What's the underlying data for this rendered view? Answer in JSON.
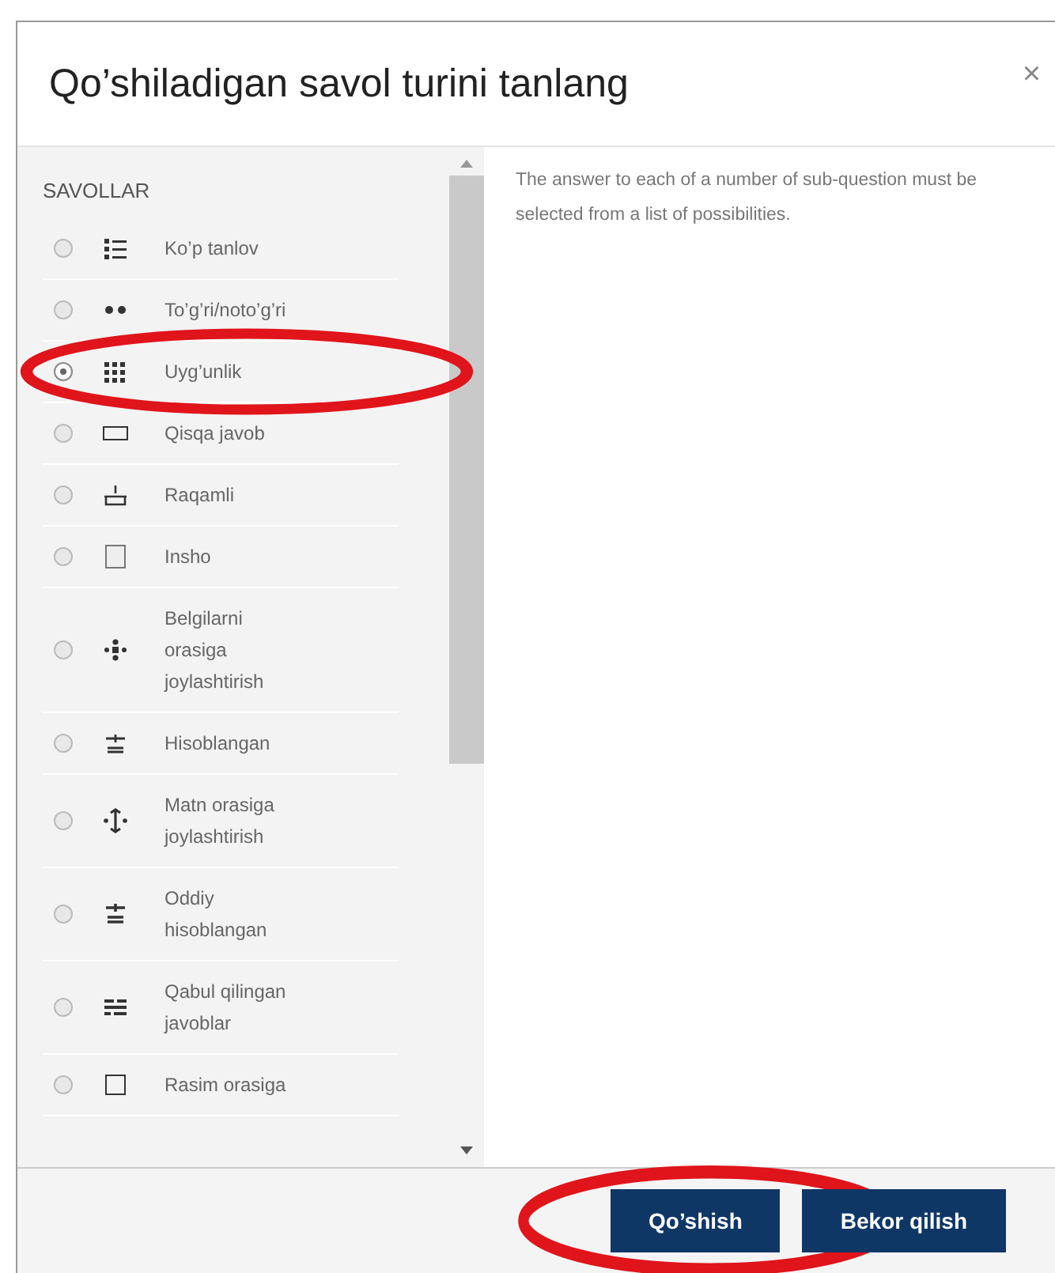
{
  "dialog": {
    "title": "Qo’shiladigan savol turini tanlang",
    "close": "×"
  },
  "list": {
    "heading": "SAVOLLAR",
    "items": [
      {
        "kind": "multichoice",
        "label": "Ko’p tanlov",
        "selected": false,
        "circled": false
      },
      {
        "kind": "truefalse",
        "label": "To’g’ri/noto’g’ri",
        "selected": false,
        "circled": false
      },
      {
        "kind": "match",
        "label": "Uyg’unlik",
        "selected": true,
        "circled": true
      },
      {
        "kind": "shortanswer",
        "label": "Qisqa javob",
        "selected": false,
        "circled": false
      },
      {
        "kind": "numerical",
        "label": "Raqamli",
        "selected": false,
        "circled": false
      },
      {
        "kind": "essay",
        "label": "Insho",
        "selected": false,
        "circled": false
      },
      {
        "kind": "ddmarker",
        "label": "Belgilarni orasiga joylashtirish",
        "selected": false,
        "circled": false
      },
      {
        "kind": "calculated",
        "label": "Hisoblangan",
        "selected": false,
        "circled": false
      },
      {
        "kind": "ddwtos",
        "label": "Matn orasiga joylashtirish",
        "selected": false,
        "circled": false
      },
      {
        "kind": "calculatedsimple",
        "label": "Oddiy hisoblangan",
        "selected": false,
        "circled": false
      },
      {
        "kind": "multianswer",
        "label": "Qabul qilingan javoblar",
        "selected": false,
        "circled": false
      },
      {
        "kind": "ddimage",
        "label": "Rasim orasiga",
        "selected": false,
        "circled": false
      }
    ]
  },
  "description": "The answer to each of a number of sub-question must be selected from a list of possibilities.",
  "buttons": [
    {
      "label": "Qo’shish",
      "circled": true
    },
    {
      "label": "Bekor qilish",
      "circled": false
    }
  ]
}
